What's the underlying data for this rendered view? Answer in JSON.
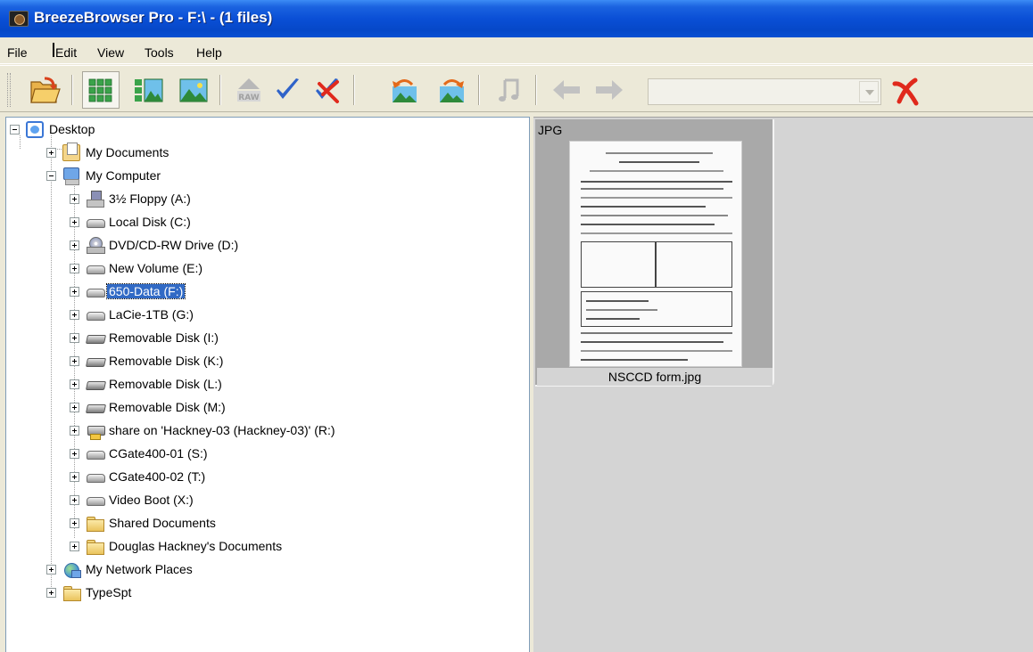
{
  "window": {
    "title": "BreezeBrowser Pro - F:\\ - (1 files)"
  },
  "menu": {
    "items": [
      "File",
      "Edit",
      "View",
      "Tools",
      "Help"
    ]
  },
  "toolbar": {
    "buttons": [
      {
        "icon": "open-folder-icon"
      },
      {
        "icon": "thumbnail-grid-icon",
        "pressed": true
      },
      {
        "icon": "thumbnail-preview-icon"
      },
      {
        "icon": "large-preview-icon"
      },
      {
        "icon": "raw-icon",
        "disabled": true
      },
      {
        "icon": "checkmark-icon"
      },
      {
        "icon": "uncheck-icon"
      },
      {
        "icon": "rotate-left-icon"
      },
      {
        "icon": "rotate-right-icon"
      },
      {
        "icon": "music-note-icon",
        "disabled": true
      },
      {
        "icon": "back-arrow-icon",
        "disabled": true
      },
      {
        "icon": "forward-arrow-icon",
        "disabled": true
      },
      {
        "icon": "cancel-icon"
      }
    ],
    "combo_value": ""
  },
  "tree": [
    {
      "label": "Desktop",
      "icon": "desktop"
    },
    {
      "label": "My Documents",
      "icon": "docs"
    },
    {
      "label": "My Computer",
      "icon": "computer"
    },
    {
      "label": "3½ Floppy (A:)",
      "icon": "floppy"
    },
    {
      "label": "Local Disk (C:)",
      "icon": "disk"
    },
    {
      "label": "DVD/CD-RW Drive (D:)",
      "icon": "dvd"
    },
    {
      "label": "New Volume (E:)",
      "icon": "disk"
    },
    {
      "label": "650-Data (F:)",
      "icon": "disk",
      "selected": true
    },
    {
      "label": "LaCie-1TB (G:)",
      "icon": "disk"
    },
    {
      "label": "Removable Disk (I:)",
      "icon": "removable"
    },
    {
      "label": "Removable Disk (K:)",
      "icon": "removable"
    },
    {
      "label": "Removable Disk (L:)",
      "icon": "removable"
    },
    {
      "label": "Removable Disk (M:)",
      "icon": "removable"
    },
    {
      "label": "share on 'Hackney-03 (Hackney-03)' (R:)",
      "icon": "network-share"
    },
    {
      "label": "CGate400-01 (S:)",
      "icon": "disk"
    },
    {
      "label": "CGate400-02 (T:)",
      "icon": "disk"
    },
    {
      "label": "Video Boot (X:)",
      "icon": "disk"
    },
    {
      "label": "Shared Documents",
      "icon": "folder"
    },
    {
      "label": "Douglas Hackney's Documents",
      "icon": "folder"
    },
    {
      "label": "My Network Places",
      "icon": "network"
    },
    {
      "label": "TypeSpt",
      "icon": "folder"
    }
  ],
  "files": [
    {
      "type": "JPG",
      "name": "NSCCD form.jpg"
    }
  ],
  "colors": {
    "titlebar": "#0a4fd6",
    "selection": "#316ac5",
    "window_bg": "#ece9d8"
  }
}
